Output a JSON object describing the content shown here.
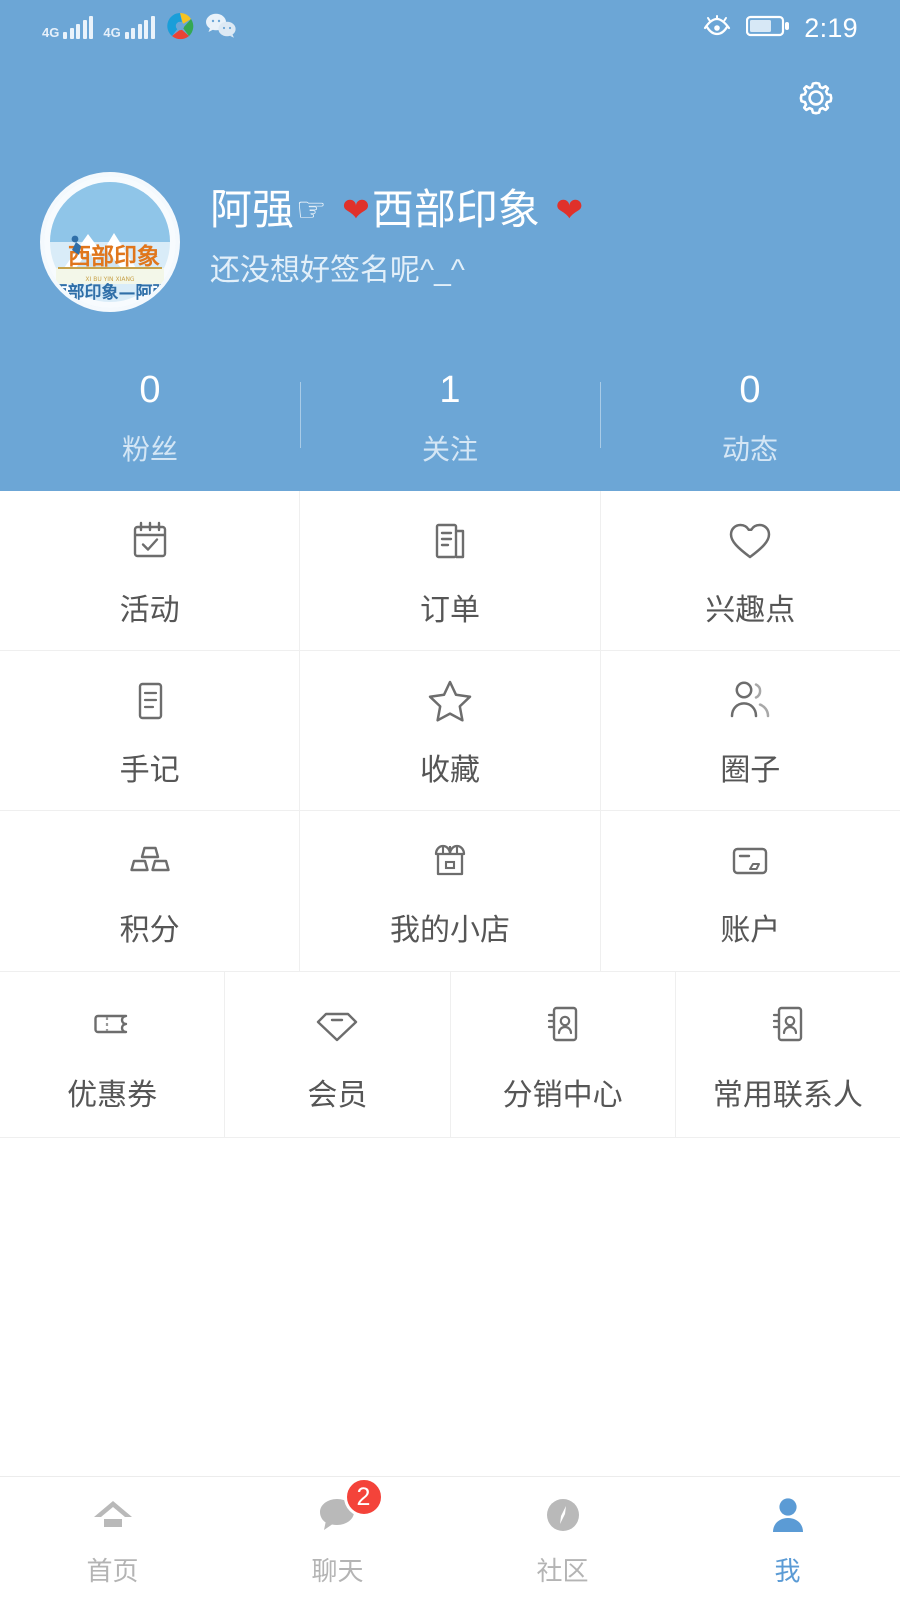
{
  "theme": {
    "header_blue": "#6ca6d6",
    "accent": "#5b9bd5",
    "badge_red": "#f4433a",
    "label_gray": "#565656",
    "tab_gray": "#b4b4b4"
  },
  "statusbar": {
    "signal_1_label": "4G",
    "signal_2_label": "4G",
    "time": "2:19",
    "icons": [
      "signal-4g-icon",
      "signal-4g-icon",
      "app-circle-icon",
      "wechat-icon",
      "eye-care-icon",
      "battery-icon"
    ]
  },
  "header": {
    "settings_icon": "gear-icon",
    "avatar_alt": "西部印象—阿强",
    "avatar_brand": "西部印象",
    "avatar_sub": "西部印象—阿强",
    "name_prefix": "阿强",
    "name_hand": "☞",
    "name_main": "西部印象",
    "heart": "❤",
    "signature": "还没想好签名呢^_^",
    "stats": [
      {
        "num": "0",
        "label": "粉丝",
        "name": "fans"
      },
      {
        "num": "1",
        "label": "关注",
        "name": "following"
      },
      {
        "num": "0",
        "label": "动态",
        "name": "posts"
      }
    ]
  },
  "grid3": [
    [
      {
        "label": "活动",
        "icon": "calendar-check-icon"
      },
      {
        "label": "订单",
        "icon": "order-document-icon"
      },
      {
        "label": "兴趣点",
        "icon": "heart-outline-icon"
      }
    ],
    [
      {
        "label": "手记",
        "icon": "note-icon"
      },
      {
        "label": "收藏",
        "icon": "star-outline-icon"
      },
      {
        "label": "圈子",
        "icon": "people-group-icon"
      }
    ],
    [
      {
        "label": "积分",
        "icon": "points-blocks-icon"
      },
      {
        "label": "我的小店",
        "icon": "shop-icon"
      },
      {
        "label": "账户",
        "icon": "card-icon"
      }
    ]
  ],
  "grid4": [
    {
      "label": "优惠券",
      "icon": "coupon-ticket-icon"
    },
    {
      "label": "会员",
      "icon": "vip-diamond-icon"
    },
    {
      "label": "分销中心",
      "icon": "contact-card-icon"
    },
    {
      "label": "常用联系人",
      "icon": "contact-card-icon"
    }
  ],
  "tabbar": [
    {
      "label": "首页",
      "icon": "home-icon",
      "active": false,
      "badge": ""
    },
    {
      "label": "聊天",
      "icon": "chat-bubble-icon",
      "active": false,
      "badge": "2"
    },
    {
      "label": "社区",
      "icon": "compass-icon",
      "active": false,
      "badge": ""
    },
    {
      "label": "我",
      "icon": "person-icon",
      "active": true,
      "badge": ""
    }
  ]
}
